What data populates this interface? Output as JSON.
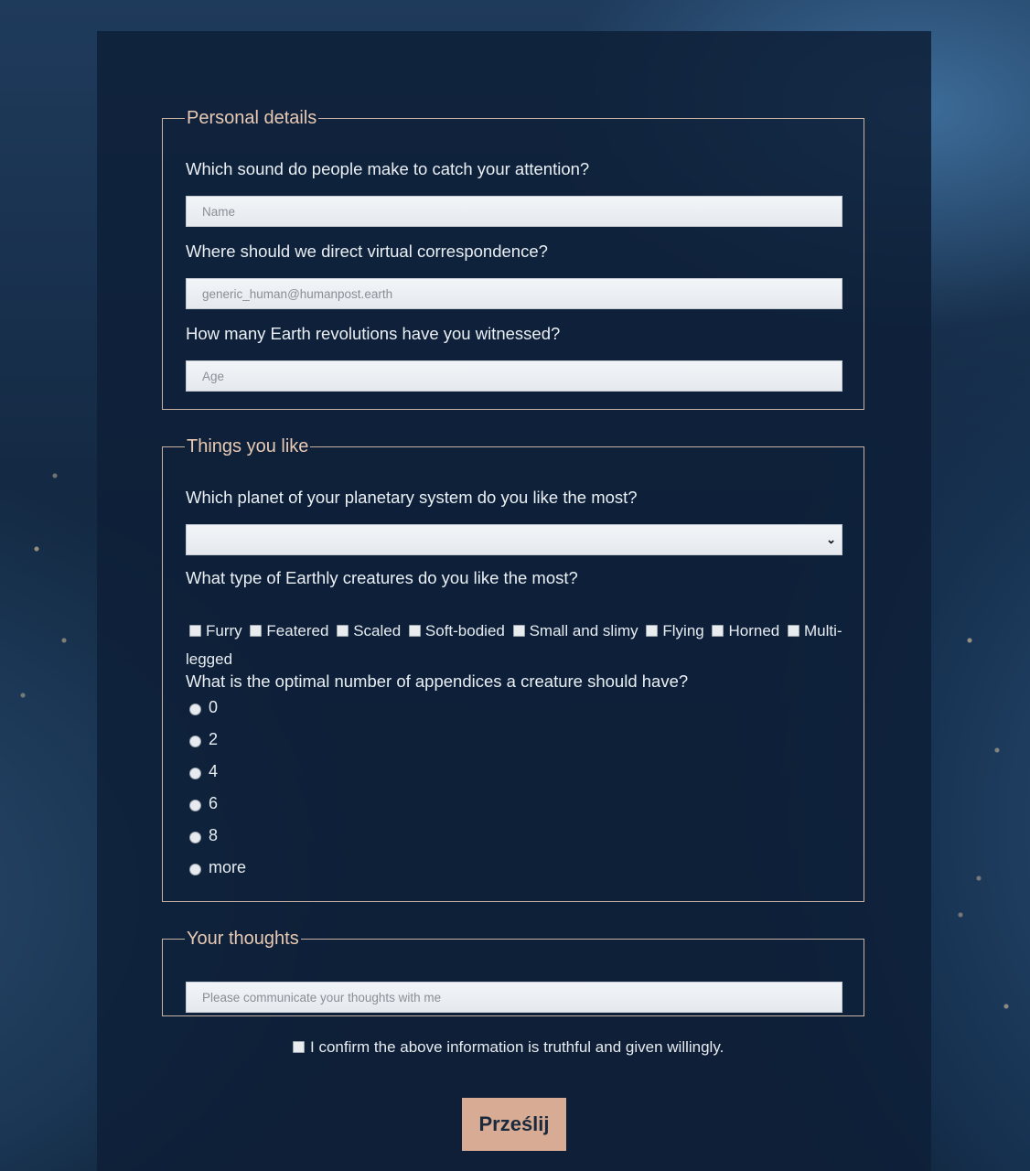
{
  "sections": {
    "personal": {
      "legend": "Personal details",
      "name_question": "Which sound do people make to catch your attention?",
      "name_placeholder": "Name",
      "email_question": "Where should we direct virtual correspondence?",
      "email_placeholder": "generic_human@humanpost.earth",
      "age_question": "How many Earth revolutions have you witnessed?",
      "age_placeholder": "Age"
    },
    "likes": {
      "legend": "Things you like",
      "planet_question": "Which planet of your planetary system do you like the most?",
      "planet_selected": "",
      "creatures_question": "What type of Earthly creatures do you like the most?",
      "creatures": [
        "Furry",
        "Featered",
        "Scaled",
        "Soft-bodied",
        "Small and slimy",
        "Flying",
        "Horned",
        "Multi-legged"
      ],
      "appendices_question": "What is the optimal number of appendices a creature should have?",
      "appendices_options": [
        "0",
        "2",
        "4",
        "6",
        "8",
        "more"
      ]
    },
    "thoughts": {
      "legend": "Your thoughts",
      "placeholder": "Please communicate your thoughts with me"
    }
  },
  "confirm_label": "I confirm the above information is truthful and given willingly.",
  "submit_label": "Prześlij",
  "icons": {
    "select_arrow": "chevron-down-icon"
  },
  "colors": {
    "accent": "#d7ab94",
    "legend": "#e8c9b3",
    "panel": "#0e2038"
  }
}
